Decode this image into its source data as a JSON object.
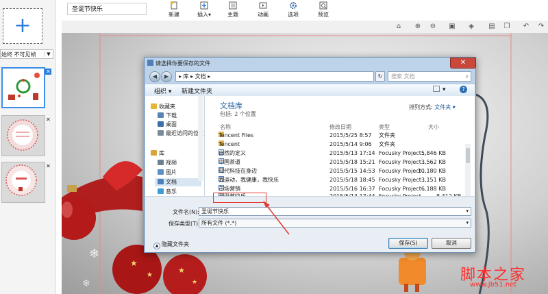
{
  "doc_title_value": "圣诞节快乐",
  "toolbar": [
    {
      "label": "新建",
      "icon": "new-doc-icon"
    },
    {
      "label": "插入",
      "icon": "insert-icon",
      "caret": "▾"
    },
    {
      "label": "主题",
      "icon": "theme-icon"
    },
    {
      "label": "动画",
      "icon": "animation-icon"
    },
    {
      "label": "选项",
      "icon": "gear-icon"
    },
    {
      "label": "预览",
      "icon": "preview-icon"
    }
  ],
  "left": {
    "add_glyph": "+",
    "visibility_option": "始终 不可见帧",
    "thumb_close": "✕"
  },
  "canvas_icons": [
    "home-icon",
    "zoom-in-icon",
    "zoom-out-icon",
    "lock-icon",
    "fill-icon",
    "align-icon",
    "copy-icon",
    "paste-icon",
    "undo-icon",
    "redo-icon"
  ],
  "dialog": {
    "title": "请选择你要保存的文件",
    "close": "✕",
    "back": "◀",
    "forward": "▶",
    "address": "▸ 库 ▸ 文档 ▸",
    "refresh": "↻",
    "search_placeholder": "搜索 文档",
    "organize": "组织 ▾",
    "new_folder": "新建文件夹",
    "view_menu": "▾",
    "help": "?",
    "nav": [
      {
        "label": "收藏夹",
        "icon": "star-icon",
        "color": "#e6b632"
      },
      {
        "label": "下载",
        "icon": "download-folder-icon",
        "color": "#5b82b5",
        "sub": true
      },
      {
        "label": "桌面",
        "icon": "desktop-icon",
        "color": "#3d6ea8",
        "sub": true
      },
      {
        "label": "最近访问的位置",
        "icon": "recent-places-icon",
        "color": "#7a8b9c",
        "sub": true
      },
      {
        "label": "库",
        "icon": "library-icon",
        "color": "#d9a53a"
      },
      {
        "label": "视频",
        "icon": "video-icon",
        "color": "#6c7f93",
        "sub": true
      },
      {
        "label": "图片",
        "icon": "pictures-icon",
        "color": "#5a8fc6",
        "sub": true
      },
      {
        "label": "文档",
        "icon": "documents-icon",
        "color": "#4d7fb8",
        "sub": true,
        "selected": true
      },
      {
        "label": "音乐",
        "icon": "music-icon",
        "color": "#3f9bd6",
        "sub": true
      }
    ],
    "library_title": "文档库",
    "library_sub": "包括: 2 个位置",
    "arrange_label": "排列方式:",
    "arrange_value": "文件夹 ▾",
    "columns": [
      "名称",
      "修改日期",
      "类型",
      "大小"
    ],
    "files": [
      {
        "name": "Tencent Files",
        "date": "2015/5/25 8:57",
        "type": "文件夹",
        "size": "",
        "folder": true
      },
      {
        "name": "Tencent",
        "date": "2015/5/14 9:06",
        "type": "文件夹",
        "size": "",
        "folder": true
      },
      {
        "name": "自然的定义",
        "date": "2015/5/13 17:14",
        "type": "Focusky Project ...",
        "size": "5,846 KB"
      },
      {
        "name": "中国茶道",
        "date": "2015/5/18 15:21",
        "type": "Focusky Project ...",
        "size": "3,562 KB"
      },
      {
        "name": "现代科技在身边",
        "date": "2015/5/15 14:53",
        "type": "Focusky Project ...",
        "size": "10,180 KB"
      },
      {
        "name": "我运动，我健康，我快乐",
        "date": "2015/5/18 18:45",
        "type": "Focusky Project ...",
        "size": "3,151 KB"
      },
      {
        "name": "市场营销",
        "date": "2015/5/16 16:37",
        "type": "Focusky Project ...",
        "size": "6,188 KB"
      },
      {
        "name": "圣诞节快乐",
        "date": "2015/5/13 17:44",
        "type": "Focusky Project ...",
        "size": "8,412 KB"
      }
    ],
    "filename_label": "文件名(N):",
    "filename_value": "圣诞节快乐",
    "filetype_label": "保存类型(T):",
    "filetype_value": "所有文件 (*.*)",
    "hide_folders": "隐藏文件夹",
    "save": "保存(S)",
    "cancel": "取消"
  },
  "watermark": "脚本之家",
  "watermark_url": "www.jb51.net",
  "colors": {
    "accent": "#2b7bd8",
    "annotation": "#e23a34",
    "watermark": "#ff2d2d"
  }
}
